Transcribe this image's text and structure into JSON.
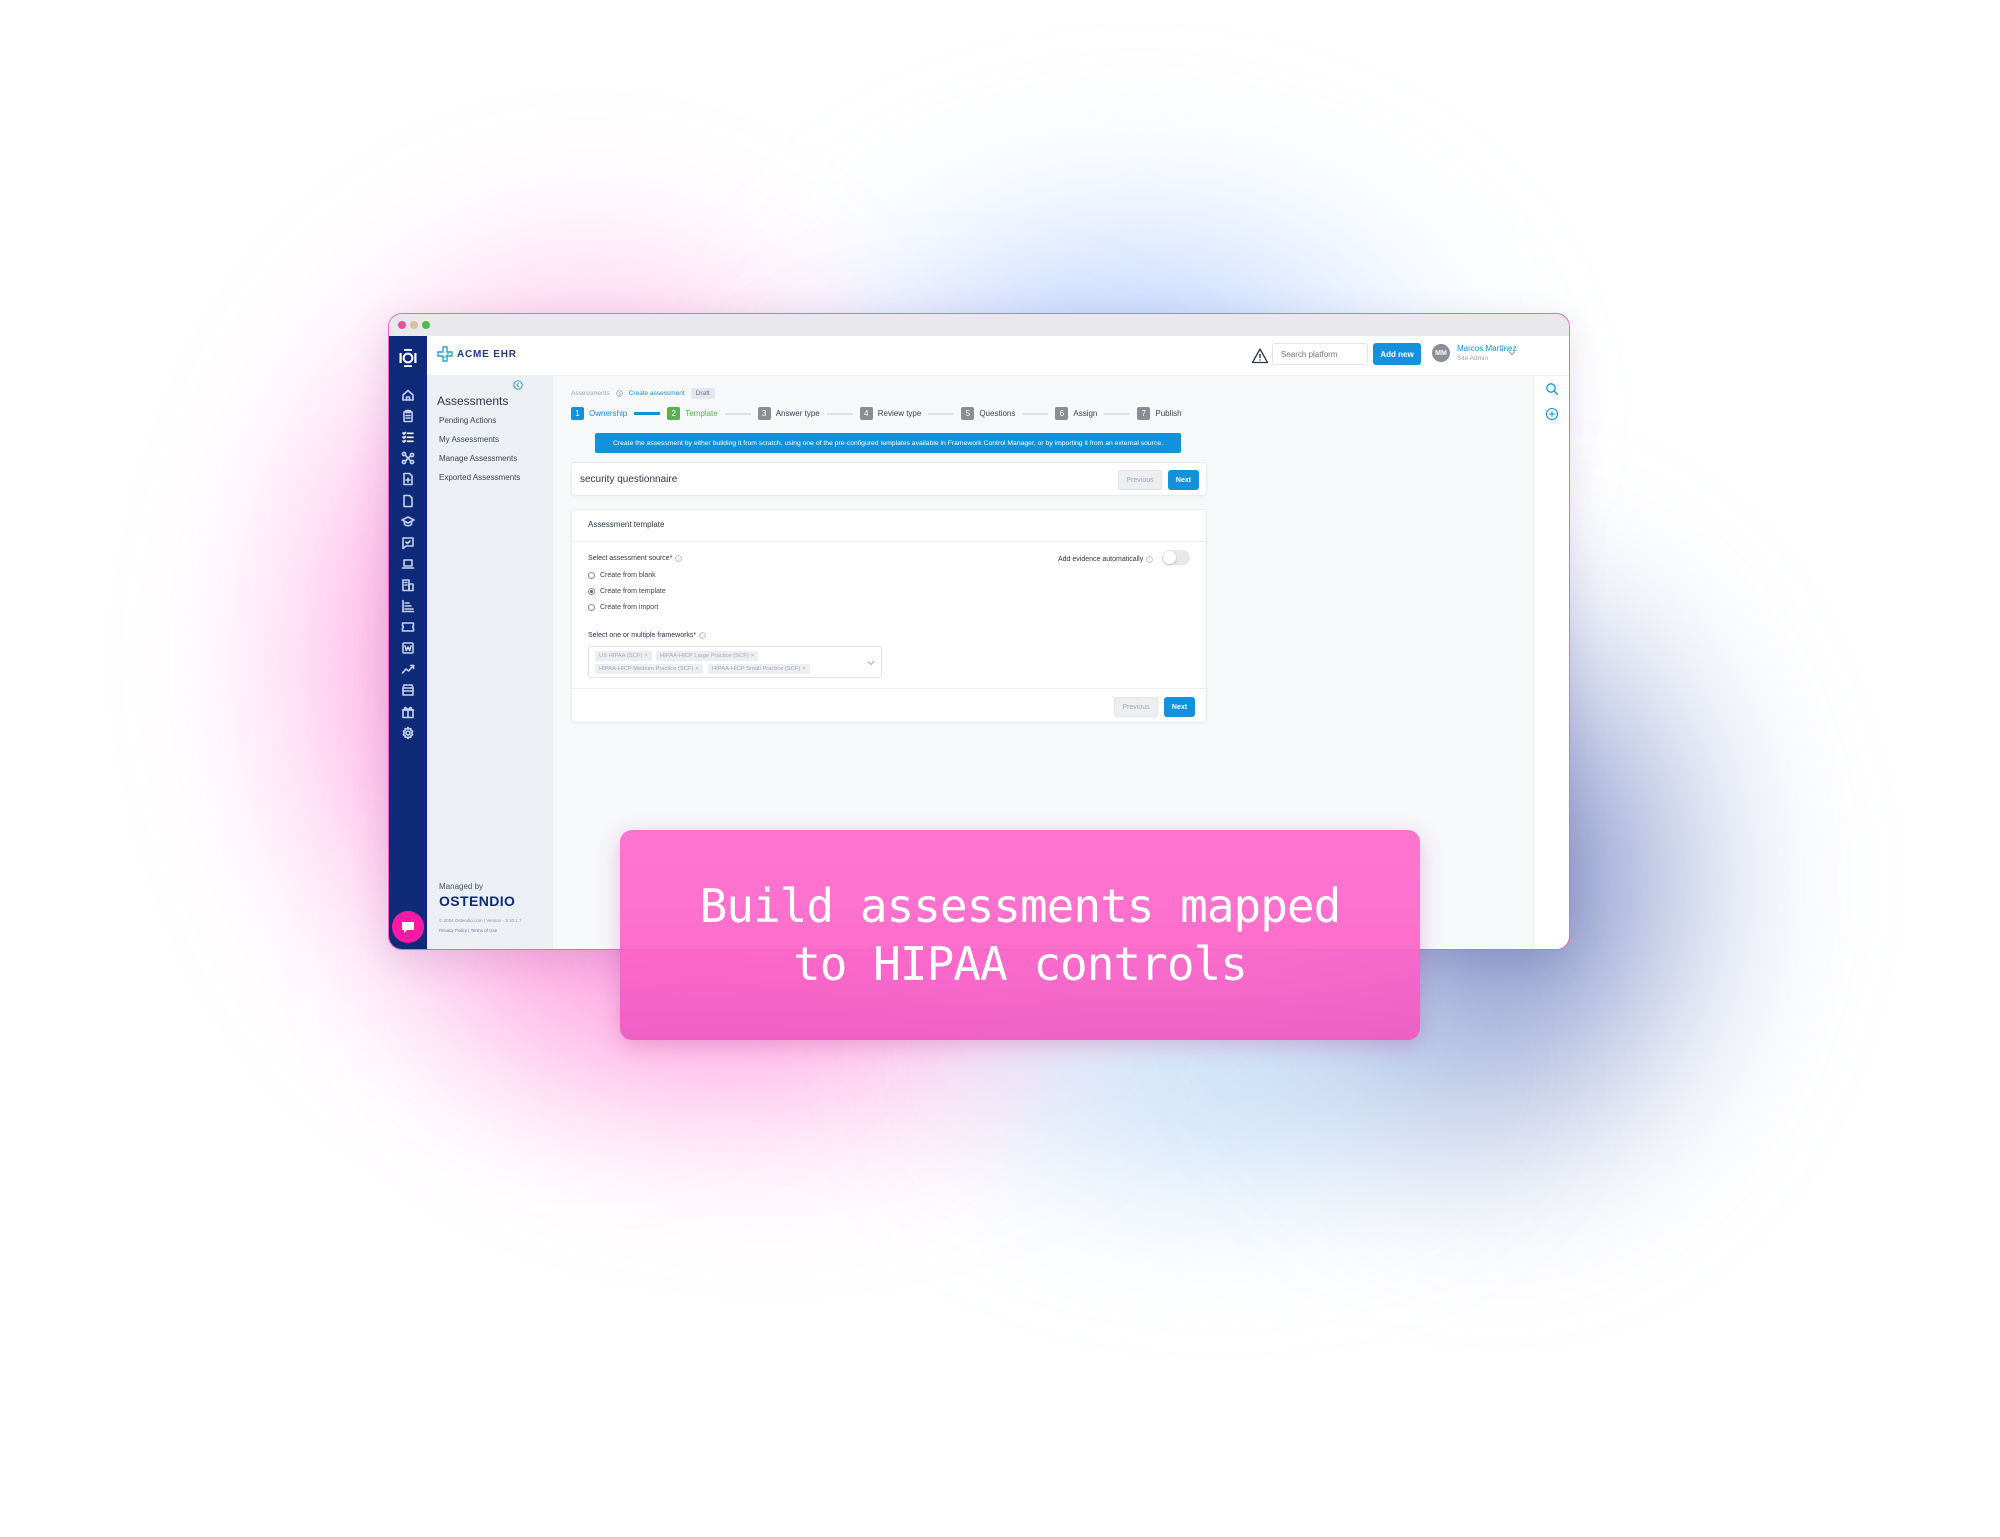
{
  "window": {
    "traffic_lights": [
      "close",
      "minimize",
      "maximize"
    ]
  },
  "header": {
    "brand_name": "ACME EHR",
    "search_placeholder": "Search platform",
    "add_new_label": "Add new",
    "user": {
      "initials": "MM",
      "name": "Marcos Martínez",
      "role": "Site Admin"
    }
  },
  "leftnav": {
    "logo_text": "lOl",
    "icons": [
      "home-icon",
      "clipboard-icon",
      "checklist-icon",
      "network-icon",
      "file-plus-icon",
      "file-icon",
      "graduation-cap-icon",
      "message-check-icon",
      "laptop-icon",
      "building-icon",
      "bar-list-icon",
      "ticket-icon",
      "word-doc-icon",
      "trending-up-icon",
      "store-icon",
      "gift-icon",
      "gear-icon"
    ],
    "active_index": 2
  },
  "submenu": {
    "title": "Assessments",
    "items": [
      {
        "label": "Pending Actions"
      },
      {
        "label": "My Assessments"
      },
      {
        "label": "Manage Assessments"
      },
      {
        "label": "Exported Assessments"
      }
    ],
    "managed_by": "Managed by",
    "vendor": "OSTENDIO",
    "copyright": "© 2024 Ostendio.com | Version - 3.10.1.7",
    "legal": "Privacy Policy | Terms of Use"
  },
  "breadcrumb": {
    "root": "Assessments",
    "current": "Create assessment",
    "badge": "Draft"
  },
  "stepper": {
    "steps": [
      {
        "num": "1",
        "label": "Ownership",
        "state": "active"
      },
      {
        "num": "2",
        "label": "Template",
        "state": "done"
      },
      {
        "num": "3",
        "label": "Answer type",
        "state": "todo"
      },
      {
        "num": "4",
        "label": "Review type",
        "state": "todo"
      },
      {
        "num": "5",
        "label": "Questions",
        "state": "todo"
      },
      {
        "num": "6",
        "label": "Assign",
        "state": "todo"
      },
      {
        "num": "7",
        "label": "Publish",
        "state": "todo"
      }
    ]
  },
  "info_banner": "Create the assessment by either building it from scratch, using one of the pre-configured templates available in Framework Control Manager, or by importing it from an external source.",
  "name_card": {
    "assessment_name": "security questionnaire",
    "previous_label": "Previous",
    "next_label": "Next"
  },
  "template_card": {
    "title": "Assessment template",
    "source_label": "Select assessment source*",
    "source_options": [
      {
        "label": "Create from blank",
        "checked": false
      },
      {
        "label": "Create from template",
        "checked": true
      },
      {
        "label": "Create from import",
        "checked": false
      }
    ],
    "evidence_label": "Add evidence automatically",
    "evidence_enabled": false,
    "frameworks_label": "Select one or multiple frameworks*",
    "frameworks_selected": [
      "US HIPAA (SCF)",
      "HIPAA-HICP Large Practice (SCF)",
      "HIPAA-HICP Medium Practice (SCF)",
      "HIPAA-HICP Small Practice (SCF)"
    ],
    "chip_remove": "×",
    "previous_label": "Previous",
    "next_label": "Next"
  },
  "caption": "Build assessments mapped to HIPAA controls",
  "colors": {
    "primary": "#1392db",
    "nav_bg": "#0e2a78",
    "success": "#55b24e",
    "accent_pink": "#ff1aa6",
    "caption_bg": "#fc6fcc"
  }
}
